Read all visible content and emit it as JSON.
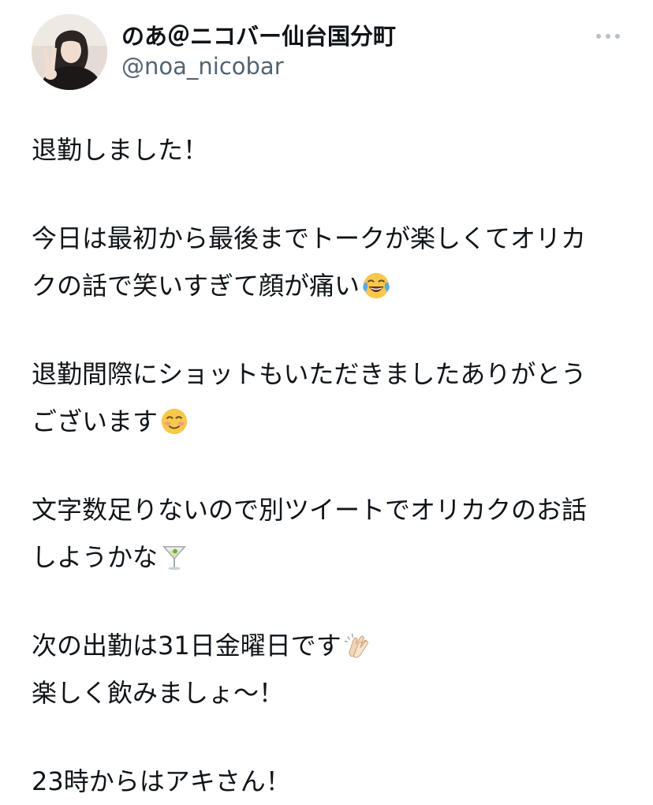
{
  "user": {
    "display_name": "のあ＠ニコバー仙台国分町",
    "handle": "@noa_nicobar"
  },
  "more_button": {
    "icon": "more-horizontal-icon",
    "label": "•••"
  },
  "tweet": {
    "lines": [
      "退勤しました！",
      "今日は最初から最後までトークが楽しくてオリカ",
      "クの話で笑いすぎて顔が痛い",
      "退勤間際にショットもいただきましたありがとう",
      "ございます",
      "文字数足りないので別ツイートでオリカクのお話",
      "しようかな",
      "次の出勤は31日金曜日です",
      "楽しく飲みましょ～！",
      "23時からはアキさん！"
    ],
    "emojis": {
      "laughing": "face-with-tears-of-joy-icon",
      "smiling": "smiling-face-icon",
      "cocktail": "cocktail-glass-icon",
      "clapping": "clapping-hands-icon"
    }
  },
  "colors": {
    "text": "#0f1419",
    "secondary": "#536471",
    "more_icon": "#b9c0c6"
  }
}
